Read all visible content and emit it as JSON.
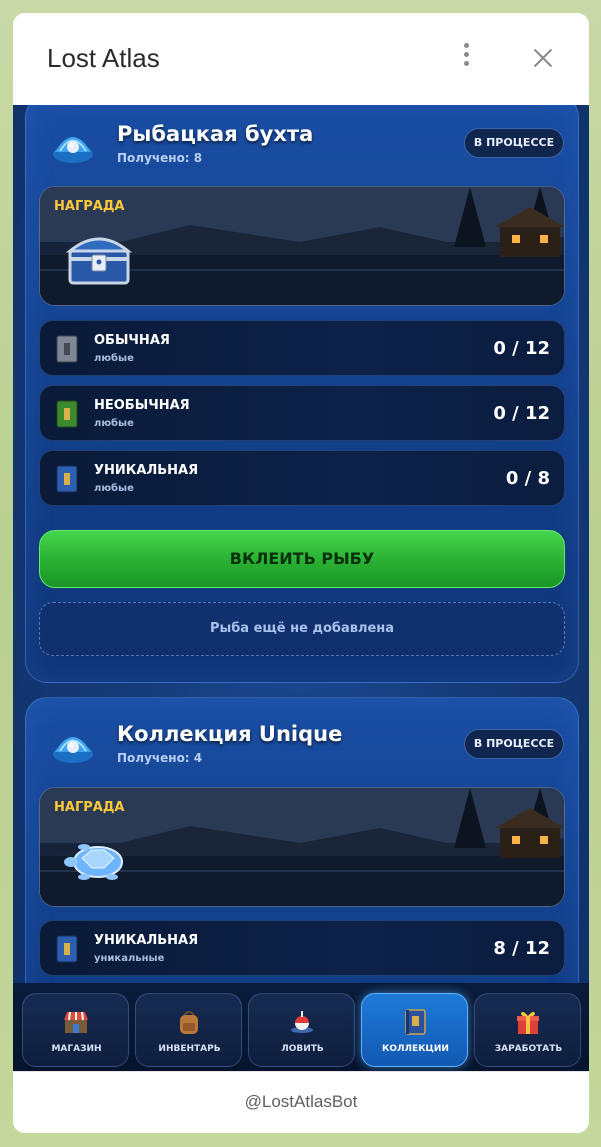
{
  "window": {
    "title": "Lost Atlas",
    "footer_text": "@LostAtlasBot"
  },
  "collections": [
    {
      "title": "Рыбацкая бухта",
      "received": "Получено: 8",
      "status": "В ПРОЦЕССЕ",
      "reward_label": "НАГРАДА",
      "reward_icon": "treasure-chest-icon",
      "requirements": [
        {
          "name": "ОБЫЧНАЯ",
          "kind": "любые",
          "count": "0 / 12",
          "icon": "gray-book-icon",
          "color": "#7f8794"
        },
        {
          "name": "НЕОБЫЧНАЯ",
          "kind": "любые",
          "count": "0 / 12",
          "icon": "green-book-icon",
          "color": "#3d8a2e"
        },
        {
          "name": "УНИКАЛЬНАЯ",
          "kind": "любые",
          "count": "0 / 8",
          "icon": "blue-book-icon",
          "color": "#2d5fb0"
        }
      ],
      "action_label": "ВКЛЕИТЬ РЫБУ",
      "empty_text": "Рыба ещё не добавлена"
    },
    {
      "title": "Коллекция Unique",
      "received": "Получено: 4",
      "status": "В ПРОЦЕССЕ",
      "reward_label": "НАГРАДА",
      "reward_icon": "crystal-turtle-icon",
      "requirements": [
        {
          "name": "УНИКАЛЬНАЯ",
          "kind": "уникальные",
          "count": "8 / 12",
          "icon": "blue-book-icon",
          "color": "#2d5fb0"
        }
      ]
    }
  ],
  "nav": [
    {
      "label": "МАГАЗИН",
      "icon": "shop-icon",
      "active": false
    },
    {
      "label": "ИНВЕНТАРЬ",
      "icon": "backpack-icon",
      "active": false
    },
    {
      "label": "ЛОВИТЬ",
      "icon": "fishing-bobber-icon",
      "active": false
    },
    {
      "label": "КОЛЛЕКЦИИ",
      "icon": "collection-book-icon",
      "active": true
    },
    {
      "label": "ЗАРАБОТАТЬ",
      "icon": "gift-icon",
      "active": false
    }
  ],
  "colors": {
    "accent_green": "#29b033",
    "reward_label": "#ffc93a",
    "active_nav": "#1f7ad8"
  }
}
